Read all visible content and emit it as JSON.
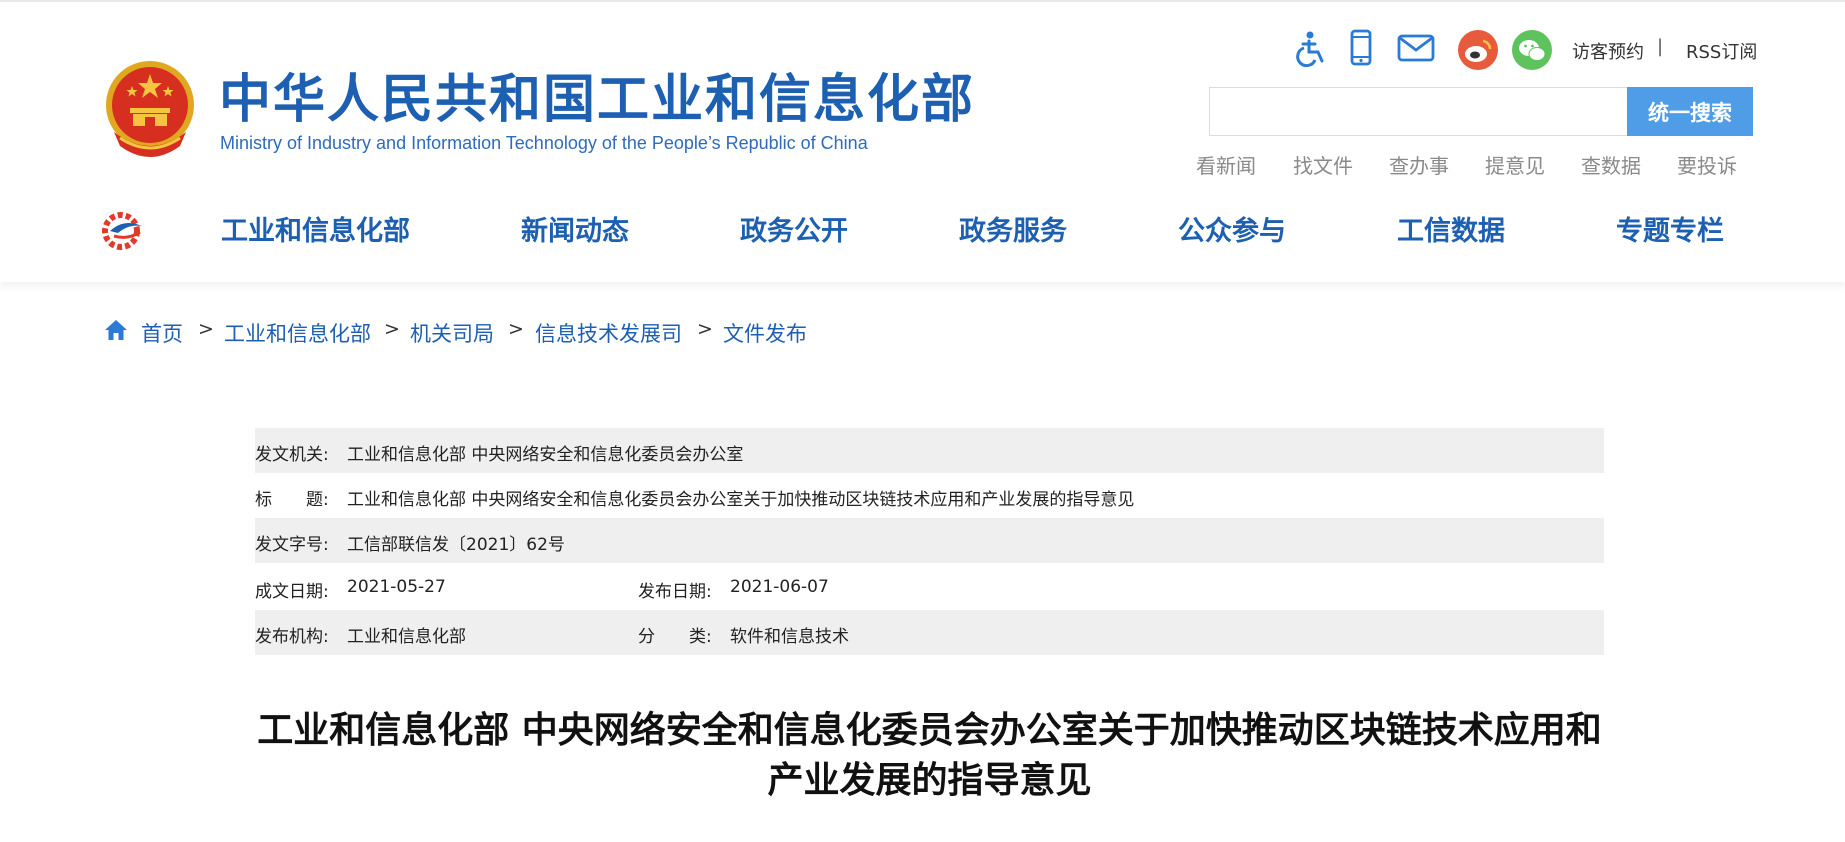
{
  "site": {
    "title": "中华人民共和国工业和信息化部",
    "subtitle": "Ministry of Industry and Information Technology of the People’s Republic of China"
  },
  "utilities": {
    "icons": [
      "accessibility-icon",
      "mobile-icon",
      "mail-icon",
      "weibo-icon",
      "wechat-icon"
    ],
    "visitor_label": "访客预约",
    "separator": "|",
    "rss_label": "RSS订阅"
  },
  "search": {
    "placeholder": "",
    "button_label": "统一搜索"
  },
  "quick_links": [
    "看新闻",
    "找文件",
    "查办事",
    "提意见",
    "查数据",
    "要投诉"
  ],
  "nav": [
    "工业和信息化部",
    "新闻动态",
    "政务公开",
    "政务服务",
    "公众参与",
    "工信数据",
    "专题专栏"
  ],
  "breadcrumb": {
    "items": [
      "首页",
      "工业和信息化部",
      "机关司局",
      "信息技术发展司",
      "文件发布"
    ],
    "separator": ">"
  },
  "meta": {
    "issuer_label": "发文机关:",
    "issuer": "工业和信息化部 中央网络安全和信息化委员会办公室",
    "title_label": "标　　题:",
    "title": "工业和信息化部 中央网络安全和信息化委员会办公室关于加快推动区块链技术应用和产业发展的指导意见",
    "doc_no_label": "发文字号:",
    "doc_no": "工信部联信发〔2021〕62号",
    "written_label": "成文日期:",
    "written_date": "2021-05-27",
    "published_label": "发布日期:",
    "published_date": "2021-06-07",
    "org_label": "发布机构:",
    "org": "工业和信息化部",
    "category_label": "分　　类:",
    "category": "软件和信息技术"
  },
  "document": {
    "title_line1": "工业和信息化部 中央网络安全和信息化委员会办公室关于加快推动区块链技术应用和",
    "title_line2": "产业发展的指导意见"
  },
  "colors": {
    "brand_blue": "#1d5fb1",
    "search_button": "#4e9de6",
    "weibo": "#e85a3c",
    "wechat": "#5ec25d",
    "meta_shade": "#efefef"
  }
}
